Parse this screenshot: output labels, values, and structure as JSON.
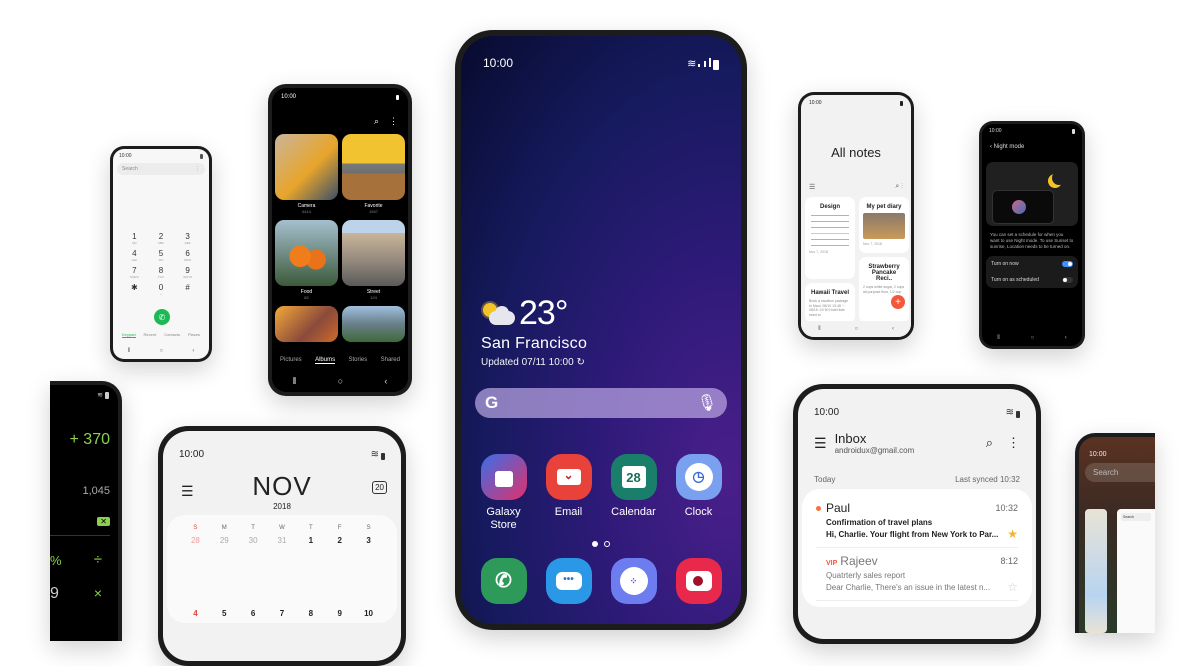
{
  "status_time": "10:00",
  "main_phone": {
    "weather": {
      "icon": "partly-sunny-icon",
      "temperature": "23°",
      "city": "San Francisco",
      "updated": "Updated 07/11 10:00"
    },
    "search_bar": {
      "logo": "G",
      "mic_icon": "mic-icon"
    },
    "apps": [
      {
        "label": "Galaxy Store",
        "icon": "shopping-bag-icon",
        "color": "#e0306a"
      },
      {
        "label": "Email",
        "icon": "envelope-icon",
        "color": "#e8423a"
      },
      {
        "label": "Calendar",
        "icon": "calendar-icon",
        "day": "28",
        "color": "#1a7f6a"
      },
      {
        "label": "Clock",
        "icon": "clock-icon",
        "color": "#7aa1f0"
      }
    ],
    "page_indicator": {
      "pages": 2,
      "current": 1
    },
    "dock": [
      {
        "name": "phone",
        "icon": "phone-icon",
        "color": "#2e9a5a"
      },
      {
        "name": "messages",
        "icon": "chat-bubble-icon",
        "color": "#2a98e6"
      },
      {
        "name": "internet",
        "icon": "internet-icon",
        "color": "#6d7df0"
      },
      {
        "name": "camera",
        "icon": "camera-icon",
        "color": "#e8294b"
      }
    ]
  },
  "dialer": {
    "search_placeholder": "Search",
    "keys": [
      {
        "d": "1",
        "l": "QD"
      },
      {
        "d": "2",
        "l": "ABC"
      },
      {
        "d": "3",
        "l": "DEF"
      },
      {
        "d": "4",
        "l": "GHI"
      },
      {
        "d": "5",
        "l": "JKL"
      },
      {
        "d": "6",
        "l": "MNO"
      },
      {
        "d": "7",
        "l": "PQRS"
      },
      {
        "d": "8",
        "l": "TUV"
      },
      {
        "d": "9",
        "l": "WXYZ"
      },
      {
        "d": "✱",
        "l": ""
      },
      {
        "d": "0",
        "l": "+"
      },
      {
        "d": "#",
        "l": ""
      }
    ],
    "tabs": [
      "Keypad",
      "Recent",
      "Contacts",
      "Places"
    ],
    "active_tab": "Keypad"
  },
  "gallery": {
    "albums": [
      {
        "name": "Camera",
        "count": "6114"
      },
      {
        "name": "Favorite",
        "count": "1947"
      },
      {
        "name": "Food",
        "count": "82"
      },
      {
        "name": "Street",
        "count": "124"
      },
      {
        "name": "",
        "count": ""
      },
      {
        "name": "",
        "count": ""
      }
    ],
    "tabs": [
      "Pictures",
      "Albums",
      "Stories",
      "Shared"
    ],
    "active_tab": "Albums"
  },
  "notes": {
    "title": "All notes",
    "cards": [
      {
        "title": "Design",
        "date": "Nov 7, 2018"
      },
      {
        "title": "My pet diary",
        "date": "Nov 7, 2018"
      },
      {
        "title": "Hawaii Travel",
        "body": "Book a vacation package to Maui. 08/10 13:45 ~ 08/15..19 50 Hotel lists need to"
      },
      {
        "title": "Strawberry Pancake Reci..",
        "body": "2 cups white sugar, 2 cups all-purpose flour, 1/2 cup"
      }
    ]
  },
  "night_mode": {
    "title": "Night mode",
    "description": "You can set a schedule for when you want to use Night mode. To use Sunset to sunrise, Location needs to be turned on.",
    "settings": [
      {
        "label": "Turn on now",
        "enabled": true
      },
      {
        "label": "Turn on as scheduled",
        "enabled": false
      }
    ]
  },
  "email": {
    "title": "Inbox",
    "account": "androidux@gmail.com",
    "section": "Today",
    "last_synced": "Last synced 10:32",
    "messages": [
      {
        "sender": "Paul",
        "time": "10:32",
        "subject": "Confirmation of travel plans",
        "preview": "Hi, Charlie. Your flight from New York to Par...",
        "unread": true,
        "starred": true,
        "vip": false
      },
      {
        "sender": "Rajeev",
        "time": "8:12",
        "subject": "Quatrterly sales report",
        "preview": "Dear Charlie, There's an issue in the latest n...",
        "unread": false,
        "starred": false,
        "vip": true,
        "vip_label": "VIP"
      }
    ]
  },
  "calendar": {
    "month": "NOV",
    "year": "2018",
    "today_badge": "20",
    "weekdays": [
      "S",
      "M",
      "T",
      "W",
      "T",
      "F",
      "S"
    ],
    "weeks": [
      [
        "28",
        "29",
        "30",
        "31",
        "1",
        "2",
        "3"
      ],
      [
        "4",
        "5",
        "6",
        "7",
        "8",
        "9",
        "10"
      ]
    ]
  },
  "calculator": {
    "expression": "+ 370",
    "result": "1,045",
    "ops": [
      "%",
      "÷",
      "9",
      "×"
    ]
  },
  "recents": {
    "search_placeholder": "Search",
    "inner_search": "Search"
  }
}
